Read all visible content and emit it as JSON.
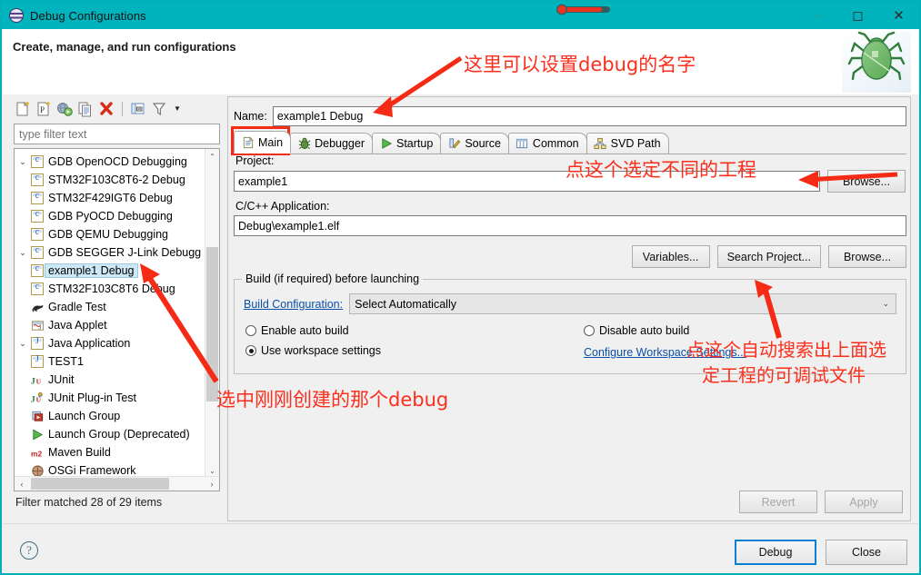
{
  "window": {
    "title": "Debug Configurations",
    "icon": "debug-configurations-icon",
    "minimize": "–",
    "maximize": "◻",
    "close": "✕"
  },
  "header": {
    "title": "Create, manage, and run configurations",
    "decor_icon": "green-bug-icon"
  },
  "tree_toolbar": {
    "items": [
      {
        "name": "new-configuration-icon",
        "tooltip": "New launch configuration"
      },
      {
        "name": "new-prototype-icon",
        "tooltip": "New prototype"
      },
      {
        "name": "export-icon",
        "tooltip": "Export"
      },
      {
        "name": "duplicate-icon",
        "tooltip": "Duplicate"
      },
      {
        "name": "delete-icon",
        "tooltip": "Delete"
      },
      {
        "name": "collapse-all-icon",
        "tooltip": "Collapse All"
      },
      {
        "name": "filter-icon",
        "tooltip": "Filter"
      },
      {
        "name": "view-menu-icon",
        "tooltip": "View Menu"
      }
    ]
  },
  "filter": {
    "placeholder": "type filter text",
    "value": "",
    "status": "Filter matched 28 of 29 items"
  },
  "tree": {
    "items": [
      {
        "label": "GDB OpenOCD Debugging",
        "indent": 0,
        "twisty": "expanded",
        "icon": "c-config-icon",
        "selected": false
      },
      {
        "label": "STM32F103C8T6-2 Debug",
        "indent": 1,
        "twisty": "",
        "icon": "c-config-icon",
        "selected": false
      },
      {
        "label": "STM32F429IGT6 Debug",
        "indent": 1,
        "twisty": "",
        "icon": "c-config-icon",
        "selected": false
      },
      {
        "label": "GDB PyOCD Debugging",
        "indent": 0,
        "twisty": "",
        "icon": "c-config-icon",
        "selected": false
      },
      {
        "label": "GDB QEMU Debugging",
        "indent": 0,
        "twisty": "",
        "icon": "c-config-icon",
        "selected": false
      },
      {
        "label": "GDB SEGGER J-Link Debugg",
        "indent": 0,
        "twisty": "expanded",
        "icon": "c-config-icon",
        "selected": false
      },
      {
        "label": "example1 Debug",
        "indent": 1,
        "twisty": "",
        "icon": "c-config-icon",
        "selected": true
      },
      {
        "label": "STM32F103C8T6 Debug",
        "indent": 1,
        "twisty": "",
        "icon": "c-config-icon",
        "selected": false
      },
      {
        "label": "Gradle Test",
        "indent": 0,
        "twisty": "",
        "icon": "gradle-icon",
        "selected": false
      },
      {
        "label": "Java Applet",
        "indent": 0,
        "twisty": "",
        "icon": "java-applet-icon",
        "selected": false
      },
      {
        "label": "Java Application",
        "indent": 0,
        "twisty": "expanded",
        "icon": "java-icon",
        "selected": false
      },
      {
        "label": "TEST1",
        "indent": 1,
        "twisty": "",
        "icon": "java-icon",
        "selected": false
      },
      {
        "label": "JUnit",
        "indent": 0,
        "twisty": "",
        "icon": "junit-icon",
        "selected": false
      },
      {
        "label": "JUnit Plug-in Test",
        "indent": 0,
        "twisty": "",
        "icon": "junit-plugin-icon",
        "selected": false
      },
      {
        "label": "Launch Group",
        "indent": 0,
        "twisty": "",
        "icon": "launch-group-icon",
        "selected": false
      },
      {
        "label": "Launch Group (Deprecated)",
        "indent": 0,
        "twisty": "",
        "icon": "launch-group-deprecated-icon",
        "selected": false
      },
      {
        "label": "Maven Build",
        "indent": 0,
        "twisty": "",
        "icon": "maven-icon",
        "selected": false
      },
      {
        "label": "OSGi Framework",
        "indent": 0,
        "twisty": "",
        "icon": "osgi-icon",
        "selected": false
      }
    ]
  },
  "config": {
    "name_label": "Name:",
    "name_value": "example1 Debug",
    "tabs": [
      {
        "label": "Main",
        "icon": "document-icon",
        "active": true
      },
      {
        "label": "Debugger",
        "icon": "bug-icon",
        "active": false
      },
      {
        "label": "Startup",
        "icon": "play-icon",
        "active": false
      },
      {
        "label": "Source",
        "icon": "source-icon",
        "active": false
      },
      {
        "label": "Common",
        "icon": "table-icon",
        "active": false
      },
      {
        "label": "SVD Path",
        "icon": "hierarchy-icon",
        "active": false
      }
    ],
    "project_label": "Project:",
    "project_value": "example1",
    "project_browse": "Browse...",
    "app_label": "C/C++ Application:",
    "app_value": "Debug\\example1.elf",
    "buttons": {
      "variables": "Variables...",
      "search_project": "Search Project...",
      "browse": "Browse..."
    },
    "build_group": {
      "legend": "Build (if required) before launching",
      "build_config_link": "Build Configuration:",
      "build_config_value": "Select Automatically",
      "enable_auto_build": "Enable auto build",
      "disable_auto_build": "Disable auto build",
      "use_workspace_settings": "Use workspace settings",
      "configure_workspace": "Configure Workspace Settings...",
      "selected_radio": "use_workspace_settings"
    },
    "revert": "Revert",
    "apply": "Apply"
  },
  "footer": {
    "help_icon": "?",
    "debug": "Debug",
    "close": "Close"
  },
  "annotations": [
    {
      "id": "a1",
      "text": "这里可以设置debug的名字"
    },
    {
      "id": "a2",
      "text": "点这个选定不同的工程"
    },
    {
      "id": "a3-line1",
      "text": "点这个自动搜索出上面选"
    },
    {
      "id": "a3-line2",
      "text": "定工程的可调试文件"
    },
    {
      "id": "a4",
      "text": "选中刚刚创建的那个debug"
    }
  ],
  "colors": {
    "titlebar": "#00b3bd",
    "annotation": "#fb2f1c",
    "selection": "#cde8f7",
    "primary_button_border": "#0a7fd6",
    "link": "#0b4fa8"
  }
}
